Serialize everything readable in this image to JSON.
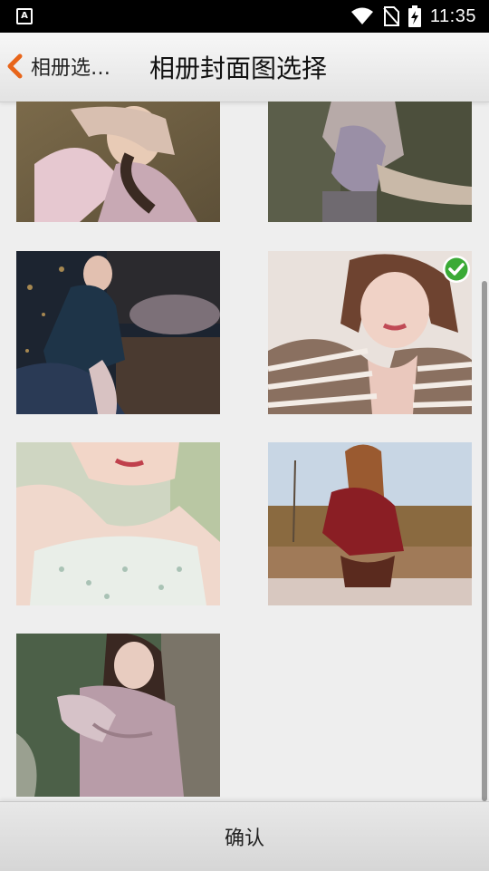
{
  "status_bar": {
    "time": "11:35",
    "app_icon_letter": "A",
    "icons": [
      "wifi-icon",
      "no-sim-icon",
      "battery-charging-icon"
    ]
  },
  "header": {
    "back_label": "相册选…",
    "title": "相册封面图选择",
    "accent_color": "#e8651a"
  },
  "photos": [
    {
      "id": "photo-1",
      "selected": false
    },
    {
      "id": "photo-2",
      "selected": false
    },
    {
      "id": "photo-3",
      "selected": false
    },
    {
      "id": "photo-4",
      "selected": true
    },
    {
      "id": "photo-5",
      "selected": false
    },
    {
      "id": "photo-6",
      "selected": false
    },
    {
      "id": "photo-7",
      "selected": false
    }
  ],
  "check_color": "#3aaa35",
  "footer": {
    "confirm_label": "确认"
  }
}
